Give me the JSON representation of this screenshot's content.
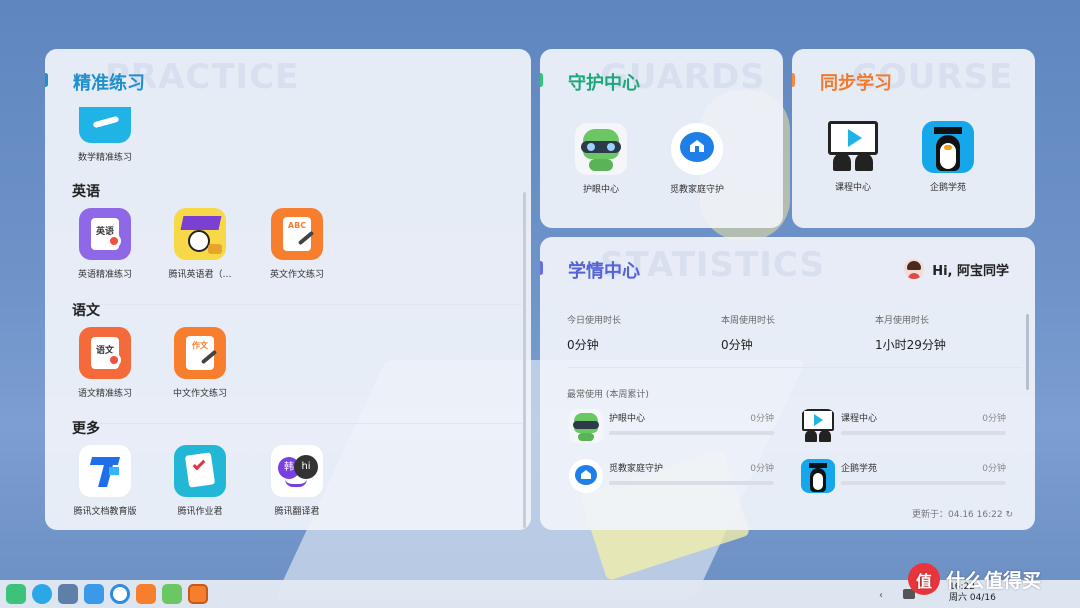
{
  "practice": {
    "title": "精准练习",
    "watermark": "PRACTICE",
    "top_app": {
      "label": "数学精准练习",
      "icon": "math-practice-icon"
    },
    "sections": [
      {
        "heading": "英语",
        "apps": [
          {
            "label": "英语精准练习",
            "icon": "english-practice-icon",
            "badge": "英语"
          },
          {
            "label": "腾讯英语君（…",
            "icon": "tencent-english-icon"
          },
          {
            "label": "英文作文练习",
            "icon": "english-essay-icon",
            "badge": "ABC"
          }
        ]
      },
      {
        "heading": "语文",
        "apps": [
          {
            "label": "语文精准练习",
            "icon": "chinese-practice-icon",
            "badge": "语文"
          },
          {
            "label": "中文作文练习",
            "icon": "chinese-essay-icon",
            "badge": "作文"
          }
        ]
      },
      {
        "heading": "更多",
        "apps": [
          {
            "label": "腾讯文档教育版",
            "icon": "tencent-docs-icon"
          },
          {
            "label": "腾讯作业君",
            "icon": "tencent-homework-icon"
          },
          {
            "label": "腾讯翻译君",
            "icon": "tencent-translate-icon",
            "badge": "韩",
            "badge2": "hi"
          }
        ]
      }
    ]
  },
  "guard": {
    "title": "守护中心",
    "watermark": "GUARDS",
    "apps": [
      {
        "label": "护眼中心",
        "icon": "eye-care-robot-icon"
      },
      {
        "label": "觅教家庭守护",
        "icon": "family-guard-icon"
      }
    ]
  },
  "course": {
    "title": "同步学习",
    "watermark": "COURSE",
    "apps": [
      {
        "label": "课程中心",
        "icon": "course-center-icon"
      },
      {
        "label": "企鹅学苑",
        "icon": "penguin-academy-icon"
      }
    ]
  },
  "stats": {
    "title": "学情中心",
    "watermark": "STATISTICS",
    "greeting": "Hi, 阿宝同学",
    "summary": [
      {
        "label": "今日使用时长",
        "value": "0分钟"
      },
      {
        "label": "本周使用时长",
        "value": "0分钟"
      },
      {
        "label": "本月使用时长",
        "value": "1小时29分钟"
      }
    ],
    "frequent_heading": "最常使用 (本周累计)",
    "frequent": [
      {
        "name": "护眼中心",
        "time": "0分钟",
        "progress": 0,
        "icon": "eye-care-robot-icon"
      },
      {
        "name": "课程中心",
        "time": "0分钟",
        "progress": 0,
        "icon": "course-center-icon"
      },
      {
        "name": "觅教家庭守护",
        "time": "0分钟",
        "progress": 0,
        "icon": "family-guard-icon"
      },
      {
        "name": "企鹅学苑",
        "time": "0分钟",
        "progress": 0,
        "icon": "penguin-academy-icon"
      }
    ],
    "updated": "更新于：04.16 16:22"
  },
  "taskbar": {
    "time": "16:22",
    "date": "周六 04/16"
  },
  "brand": {
    "text": "什么值得买"
  },
  "colors": {
    "practice_accent": "#1f8fce",
    "guard_accent": "#1ea879",
    "course_accent": "#f07a2f",
    "stats_accent": "#5563d6"
  }
}
